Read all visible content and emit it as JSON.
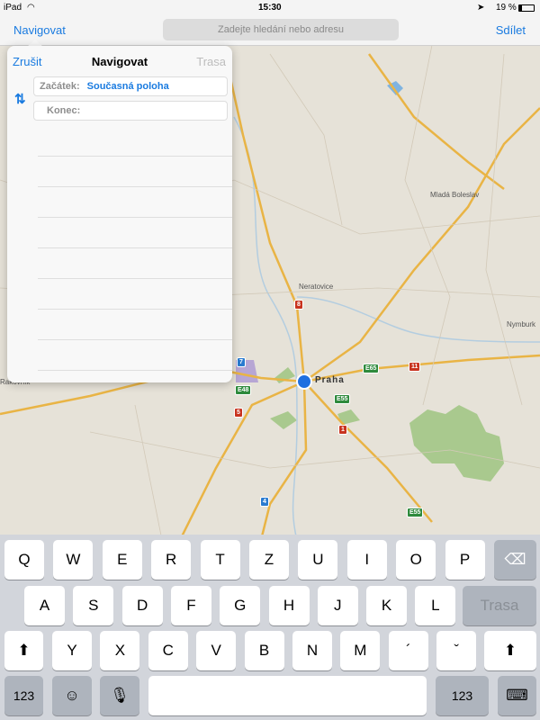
{
  "status": {
    "device": "iPad",
    "time": "15:30",
    "battery": "19 %"
  },
  "navbar": {
    "left": "Navigovat",
    "search_placeholder": "Zadejte hledání nebo adresu",
    "right": "Sdílet"
  },
  "popover": {
    "cancel": "Zrušit",
    "title": "Navigovat",
    "route": "Trasa",
    "start_label": "Začátek:",
    "start_value": "Současná poloha",
    "end_label": "Konec:"
  },
  "map": {
    "places": [
      "Mladá Boleslav",
      "Neratovice",
      "Praha",
      "Nymburk",
      "Rakovník"
    ],
    "shields": [
      {
        "label": "8",
        "color": "#c8331f"
      },
      {
        "label": "7",
        "color": "#2a7bd0"
      },
      {
        "label": "E48",
        "color": "#2e8a3c"
      },
      {
        "label": "5",
        "color": "#c8331f"
      },
      {
        "label": "E65",
        "color": "#2e8a3c"
      },
      {
        "label": "11",
        "color": "#c8331f"
      },
      {
        "label": "E55",
        "color": "#2e8a3c"
      },
      {
        "label": "1",
        "color": "#c8331f"
      },
      {
        "label": "4",
        "color": "#2a7bd0"
      },
      {
        "label": "E55",
        "color": "#2e8a3c"
      }
    ]
  },
  "keyboard": {
    "row1": [
      "Q",
      "W",
      "E",
      "R",
      "T",
      "Z",
      "U",
      "I",
      "O",
      "P"
    ],
    "row2": [
      "A",
      "S",
      "D",
      "F",
      "G",
      "H",
      "J",
      "K",
      "L"
    ],
    "row3": [
      "Y",
      "X",
      "C",
      "V",
      "B",
      "N",
      "M",
      "´",
      "ˇ"
    ],
    "return_label": "Trasa",
    "numbers_label": "123"
  }
}
